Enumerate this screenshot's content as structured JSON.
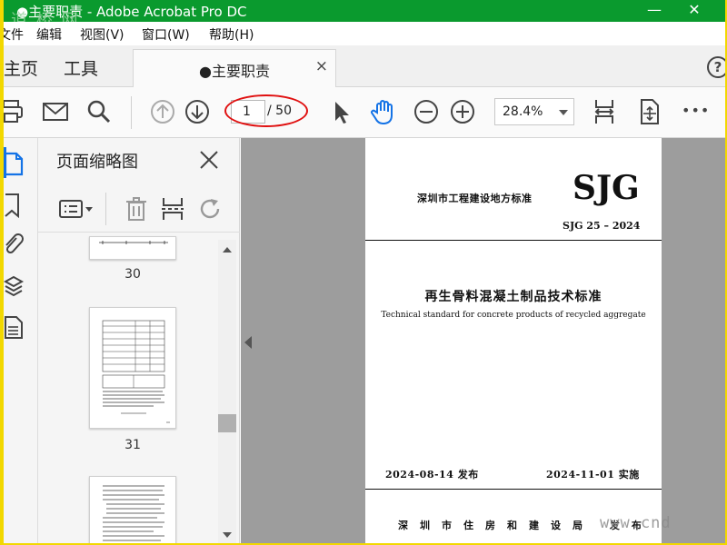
{
  "window": {
    "title": "●主要职责 - Adobe Acrobat Pro DC",
    "minimize": "—",
    "close": "✕"
  },
  "watermark": {
    "cn": "道 桥 网",
    "en": "www.cnd"
  },
  "menu": {
    "items": [
      "文件",
      "编辑",
      "视图(V)",
      "窗口(W)",
      "帮助(H)"
    ]
  },
  "tabs": {
    "home": "主页",
    "tools": "工具",
    "document": "●主要职责",
    "close": "×",
    "help": "?"
  },
  "toolbar": {
    "current_page": "1",
    "total_pages": "/ 50",
    "zoom": "28.4%",
    "more": "•••"
  },
  "thumbnails": {
    "panel_title": "页面缩略图",
    "pages": [
      "30",
      "31"
    ]
  },
  "document_page": {
    "header_cn": "深圳市工程建设地方标准",
    "logo": "SJG",
    "standard_no": "SJG  25  –  2024",
    "title_cn": "再生骨料混凝土制品技术标准",
    "title_en": "Technical standard for concrete products of recycled aggregate",
    "publish_date": "2024-08-14  发布",
    "implement_date": "2024-11-01  实施",
    "issuer": "深圳市住房和建设局  发布"
  },
  "colors": {
    "titlebar": "#0a9a2e",
    "accent_blue": "#1473e6",
    "highlight_red": "#e01010",
    "frame_yellow": "#f2d800"
  }
}
